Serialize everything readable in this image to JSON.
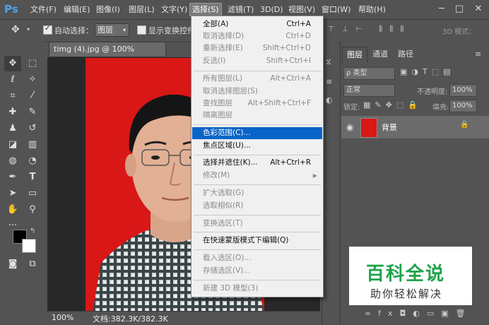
{
  "app": {
    "logo": "Ps"
  },
  "menubar": {
    "items": [
      "文件(F)",
      "编辑(E)",
      "图像(I)",
      "图层(L)",
      "文字(Y)",
      "选择(S)",
      "滤镜(T)",
      "3D(D)",
      "视图(V)",
      "窗口(W)",
      "帮助(H)"
    ],
    "active": "选择(S)"
  },
  "window_controls": {
    "minimize": "─",
    "maximize": "□",
    "close": "✕"
  },
  "options_bar": {
    "auto_select_label": "自动选择：",
    "auto_select_checked": true,
    "auto_select_target": "图层",
    "show_transform_label": "显示变换控件",
    "show_transform_checked": false,
    "mode_3d_label": "3D 模式："
  },
  "document": {
    "tab_title": "timg (4).jpg @ 100%(RGB/8#)",
    "tab_close": "×",
    "zoom": "100%",
    "doc_info": "文档:382.3K/382.3K"
  },
  "select_menu": {
    "items": [
      {
        "label": "全部(A)",
        "shortcut": "Ctrl+A",
        "disabled": false
      },
      {
        "label": "取消选择(D)",
        "shortcut": "Ctrl+D",
        "disabled": true
      },
      {
        "label": "重新选择(E)",
        "shortcut": "Shift+Ctrl+D",
        "disabled": true
      },
      {
        "label": "反选(I)",
        "shortcut": "Shift+Ctrl+I",
        "disabled": true
      },
      {
        "label": "所有图层(L)",
        "shortcut": "Alt+Ctrl+A",
        "disabled": true
      },
      {
        "label": "取消选择图层(S)",
        "shortcut": "",
        "disabled": true
      },
      {
        "label": "查找图层",
        "shortcut": "Alt+Shift+Ctrl+F",
        "disabled": true
      },
      {
        "label": "隔离图层",
        "shortcut": "",
        "disabled": true
      },
      {
        "label": "色彩范围(C)...",
        "shortcut": "",
        "disabled": false,
        "highlighted": true
      },
      {
        "label": "焦点区域(U)...",
        "shortcut": "",
        "disabled": false
      },
      {
        "label": "选择并遮住(K)...",
        "shortcut": "Alt+Ctrl+R",
        "disabled": false
      },
      {
        "label": "修改(M)",
        "shortcut": "",
        "disabled": true,
        "submenu": true
      },
      {
        "label": "扩大选取(G)",
        "shortcut": "",
        "disabled": true
      },
      {
        "label": "选取相似(R)",
        "shortcut": "",
        "disabled": true
      },
      {
        "label": "变换选区(T)",
        "shortcut": "",
        "disabled": true
      },
      {
        "label": "在快速蒙版模式下编辑(Q)",
        "shortcut": "",
        "disabled": false
      },
      {
        "label": "载入选区(O)...",
        "shortcut": "",
        "disabled": true
      },
      {
        "label": "存储选区(V)...",
        "shortcut": "",
        "disabled": true
      },
      {
        "label": "新建 3D 模型(3)",
        "shortcut": "",
        "disabled": true
      }
    ],
    "submenu_arrow": "▶"
  },
  "layers_panel": {
    "tabs": [
      "图层",
      "通道",
      "路径"
    ],
    "active_tab": "图层",
    "filter_kind": "ρ 类型",
    "blend_mode": "正常",
    "opacity_label": "不透明度:",
    "opacity_value": "100%",
    "lock_label": "锁定:",
    "fill_label": "填充:",
    "fill_value": "100%",
    "layer_name": "背景"
  },
  "watermark": {
    "title": "百科全说",
    "subtitle": "助你轻松解决"
  },
  "colors": {
    "menu_highlight": "#0a64c8",
    "photo_background": "#d91717",
    "watermark_green": "#1ea34a"
  }
}
